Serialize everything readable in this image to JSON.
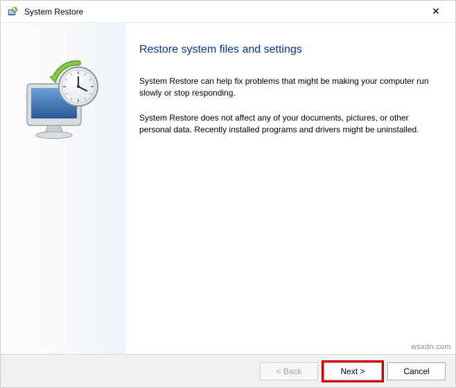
{
  "titlebar": {
    "title": "System Restore",
    "close_label": "✕"
  },
  "main": {
    "heading": "Restore system files and settings",
    "paragraph1": "System Restore can help fix problems that might be making your computer run slowly or stop responding.",
    "paragraph2": "System Restore does not affect any of your documents, pictures, or other personal data. Recently installed programs and drivers might be uninstalled."
  },
  "footer": {
    "back_label": "< Back",
    "next_label": "Next >",
    "cancel_label": "Cancel"
  },
  "watermark": "wsxdn.com"
}
